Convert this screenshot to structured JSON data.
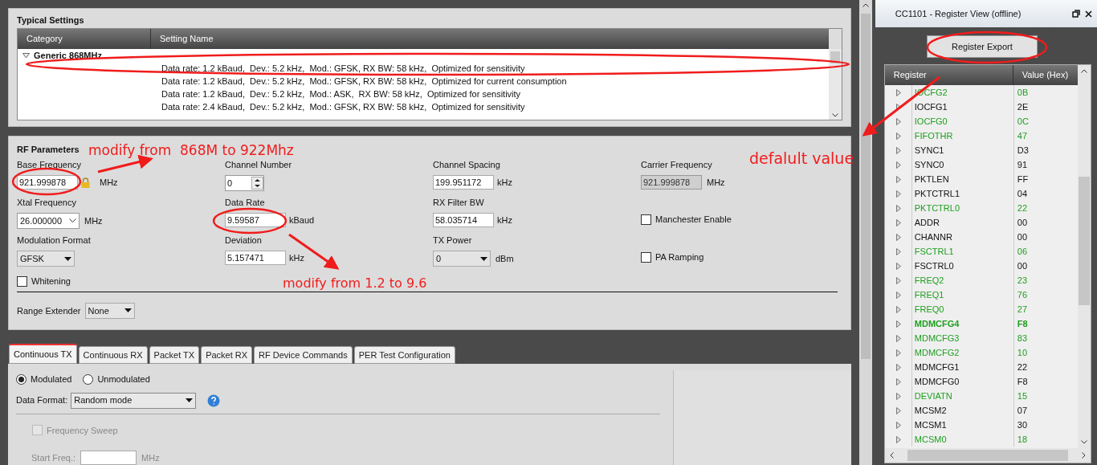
{
  "typical_settings": {
    "title": "Typical Settings",
    "columns": [
      "Category",
      "Setting Name"
    ],
    "category": {
      "label": "Generic 868MHz",
      "expanded": true
    },
    "settings": [
      {
        "text": "Data rate: 1.2 kBaud,  Dev.: 5.2 kHz,  Mod.: GFSK, RX BW: 58 kHz,  Optimized for sensitivity"
      },
      {
        "text": "Data rate: 1.2 kBaud,  Dev.: 5.2 kHz,  Mod.: GFSK, RX BW: 58 kHz,  Optimized for current consumption"
      },
      {
        "text": "Data rate: 1.2 kBaud,  Dev.: 5.2 kHz,  Mod.: ASK,  RX BW: 58 kHz,  Optimized for sensitivity"
      },
      {
        "text": "Data rate: 2.4 kBaud,  Dev.: 5.2 kHz,  Mod.: GFSK, RX BW: 58 kHz,  Optimized for sensitivity"
      }
    ]
  },
  "rf_parameters": {
    "title": "RF Parameters",
    "columns": [
      [
        {
          "kind": "input",
          "label": "Base Frequency",
          "value": "921.999878",
          "unit": "MHz",
          "locked": true
        },
        {
          "kind": "combo",
          "label": "Xtal Frequency",
          "value": "26.000000",
          "unit": "MHz"
        },
        {
          "kind": "select",
          "label": "Modulation Format",
          "value": "GFSK"
        },
        {
          "kind": "checkbox",
          "label": "Whitening",
          "checked": false
        }
      ],
      [
        {
          "kind": "spinner",
          "label": "Channel Number",
          "value": "0"
        },
        {
          "kind": "input",
          "label": "Data Rate",
          "value": "9.59587",
          "unit": "kBaud"
        },
        {
          "kind": "input",
          "label": "Deviation",
          "value": "5.157471",
          "unit": "kHz"
        }
      ],
      [
        {
          "kind": "input",
          "label": "Channel Spacing",
          "value": "199.951172",
          "unit": "kHz"
        },
        {
          "kind": "input",
          "label": "RX Filter BW",
          "value": "58.035714",
          "unit": "kHz"
        },
        {
          "kind": "select",
          "label": "TX Power",
          "value": "0",
          "unit": "dBm"
        }
      ],
      [
        {
          "kind": "readonly",
          "label": "Carrier Frequency",
          "value": "921.999878",
          "unit": "MHz"
        },
        {
          "kind": "checkbox",
          "label": "Manchester Enable",
          "checked": false
        },
        {
          "kind": "checkbox",
          "label": "PA Ramping",
          "checked": false
        }
      ]
    ],
    "range_extender": {
      "label": "Range Extender",
      "value": "None"
    }
  },
  "tabs": [
    {
      "label": "Continuous TX",
      "selected": true
    },
    {
      "label": "Continuous RX",
      "selected": false
    },
    {
      "label": "Packet TX",
      "selected": false
    },
    {
      "label": "Packet RX",
      "selected": false
    },
    {
      "label": "RF Device Commands",
      "selected": false
    },
    {
      "label": "PER Test Configuration",
      "selected": false
    }
  ],
  "continuous_tx": {
    "modes": [
      {
        "label": "Modulated",
        "selected": true
      },
      {
        "label": "Unmodulated",
        "selected": false
      }
    ],
    "data_format": {
      "label": "Data Format:",
      "value": "Random mode"
    },
    "frequency_sweep": {
      "label": "Frequency Sweep",
      "checked": false,
      "disabled": true
    },
    "start_freq": {
      "label": "Start Freq.:",
      "unit": "MHz",
      "disabled": true
    }
  },
  "register_view": {
    "title": "CC1101 - Register View (offline)",
    "export_button": "Register Export",
    "columns": [
      "Register",
      "Value (Hex)"
    ],
    "registers": [
      {
        "name": "IOCFG2",
        "value": "0B",
        "changed": true,
        "selected": false
      },
      {
        "name": "IOCFG1",
        "value": "2E",
        "changed": false,
        "selected": false
      },
      {
        "name": "IOCFG0",
        "value": "0C",
        "changed": true,
        "selected": false
      },
      {
        "name": "FIFOTHR",
        "value": "47",
        "changed": true,
        "selected": false
      },
      {
        "name": "SYNC1",
        "value": "D3",
        "changed": false,
        "selected": false
      },
      {
        "name": "SYNC0",
        "value": "91",
        "changed": false,
        "selected": false
      },
      {
        "name": "PKTLEN",
        "value": "FF",
        "changed": false,
        "selected": false
      },
      {
        "name": "PKTCTRL1",
        "value": "04",
        "changed": false,
        "selected": false
      },
      {
        "name": "PKTCTRL0",
        "value": "22",
        "changed": true,
        "selected": false
      },
      {
        "name": "ADDR",
        "value": "00",
        "changed": false,
        "selected": false
      },
      {
        "name": "CHANNR",
        "value": "00",
        "changed": false,
        "selected": false
      },
      {
        "name": "FSCTRL1",
        "value": "06",
        "changed": true,
        "selected": false
      },
      {
        "name": "FSCTRL0",
        "value": "00",
        "changed": false,
        "selected": false
      },
      {
        "name": "FREQ2",
        "value": "23",
        "changed": true,
        "selected": false
      },
      {
        "name": "FREQ1",
        "value": "76",
        "changed": true,
        "selected": false
      },
      {
        "name": "FREQ0",
        "value": "27",
        "changed": true,
        "selected": false
      },
      {
        "name": "MDMCFG4",
        "value": "F8",
        "changed": true,
        "selected": true
      },
      {
        "name": "MDMCFG3",
        "value": "83",
        "changed": true,
        "selected": false
      },
      {
        "name": "MDMCFG2",
        "value": "10",
        "changed": true,
        "selected": false
      },
      {
        "name": "MDMCFG1",
        "value": "22",
        "changed": false,
        "selected": false
      },
      {
        "name": "MDMCFG0",
        "value": "F8",
        "changed": false,
        "selected": false
      },
      {
        "name": "DEVIATN",
        "value": "15",
        "changed": true,
        "selected": false
      },
      {
        "name": "MCSM2",
        "value": "07",
        "changed": false,
        "selected": false
      },
      {
        "name": "MCSM1",
        "value": "30",
        "changed": false,
        "selected": false
      },
      {
        "name": "MCSM0",
        "value": "18",
        "changed": true,
        "selected": false
      }
    ]
  },
  "annotations": [
    {
      "text": "modify from  868M to 922Mhz"
    },
    {
      "text": "modify from 1.2 to 9.6"
    },
    {
      "text": "defalult value"
    }
  ]
}
